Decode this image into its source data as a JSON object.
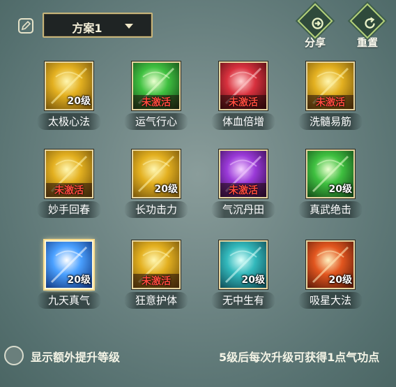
{
  "header": {
    "plan_label": "方案1",
    "share_label": "分享",
    "reset_label": "重置"
  },
  "skills": [
    {
      "name": "太极心法",
      "status": "20级",
      "locked": false,
      "theme": "gold"
    },
    {
      "name": "运气行心",
      "status": "未激活",
      "locked": true,
      "theme": "green"
    },
    {
      "name": "体血倍增",
      "status": "未激活",
      "locked": true,
      "theme": "red"
    },
    {
      "name": "洗髓易筋",
      "status": "未激活",
      "locked": true,
      "theme": "gold"
    },
    {
      "name": "妙手回春",
      "status": "未激活",
      "locked": true,
      "theme": "gold"
    },
    {
      "name": "长功击力",
      "status": "20级",
      "locked": false,
      "theme": "gold"
    },
    {
      "name": "气沉丹田",
      "status": "未激活",
      "locked": true,
      "theme": "purple"
    },
    {
      "name": "真武绝击",
      "status": "20级",
      "locked": false,
      "theme": "green"
    },
    {
      "name": "九天真气",
      "status": "20级",
      "locked": false,
      "theme": "blue"
    },
    {
      "name": "狂意护体",
      "status": "未激活",
      "locked": true,
      "theme": "gold"
    },
    {
      "name": "无中生有",
      "status": "20级",
      "locked": false,
      "theme": "cyan"
    },
    {
      "name": "吸星大法",
      "status": "20级",
      "locked": false,
      "theme": "orange"
    }
  ],
  "footer": {
    "toggle_label": "显示额外提升等级",
    "hint": "5级后每次升级可获得1点气功点"
  },
  "colors": {
    "locked_text": "#ff4b3f",
    "frame": "#e6d5a0",
    "action_green": "#b5d27a"
  }
}
